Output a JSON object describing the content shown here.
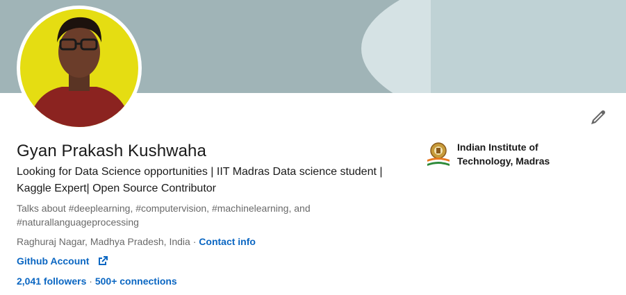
{
  "profile": {
    "name": "Gyan Prakash Kushwaha",
    "headline": "Looking for Data Science opportunities | IIT Madras Data science student | Kaggle Expert| Open Source Contributor",
    "talks_about": "Talks about #deeplearning, #computervision, #machinelearning, and #naturallanguageprocessing",
    "location": "Raghuraj Nagar, Madhya Pradesh, India",
    "location_separator": " · ",
    "contact_info_label": "Contact info",
    "website_label": "Github Account",
    "followers": "2,041 followers",
    "stats_separator": " · ",
    "connections": "500+ connections"
  },
  "education": {
    "school_name": "Indian Institute of Technology, Madras"
  },
  "colors": {
    "link": "#0a66c2",
    "banner": "#a0b4b7",
    "avatar_bg": "#e5dd12"
  },
  "icons": {
    "edit": "pencil-icon",
    "external_link": "external-link-icon"
  }
}
